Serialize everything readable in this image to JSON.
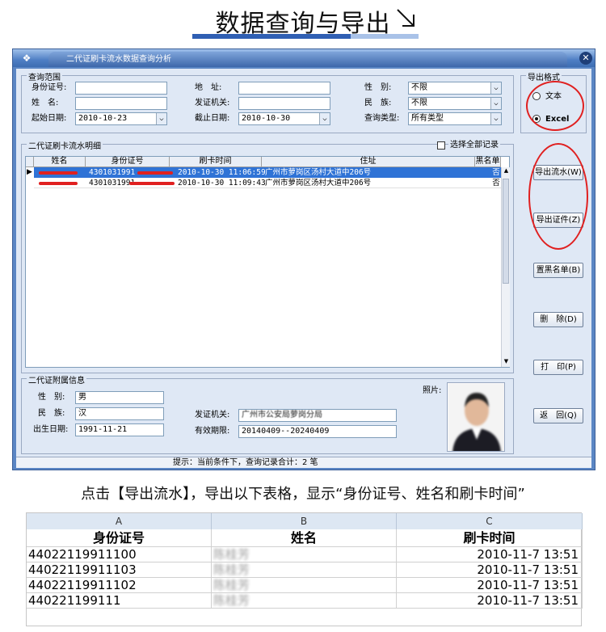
{
  "banner": {
    "title": "数据查询与导出"
  },
  "window": {
    "title": "二代证刷卡流水数据查询分析",
    "query_range": {
      "label": "查询范围",
      "id_no_label": "身份证号:",
      "name_label": "姓　名:",
      "start_date_label": "起始日期:",
      "start_date": "2010-10-23",
      "address_label": "地　址:",
      "issuer_label": "发证机关:",
      "end_date_label": "截止日期:",
      "end_date": "2010-10-30",
      "gender_label": "性　别:",
      "gender_value": "不限",
      "ethnic_label": "民　族:",
      "ethnic_value": "不限",
      "query_type_label": "查询类型:",
      "query_type_value": "所有类型"
    },
    "export_format": {
      "label": "导出格式",
      "text_option": "文本",
      "excel_option": "Excel",
      "selected": "Excel"
    },
    "detail": {
      "label": "二代证刷卡流水明细",
      "select_all": "选择全部记录",
      "columns": [
        "姓名",
        "身份证号",
        "刷卡时间",
        "住址",
        "黑名单"
      ],
      "rows": [
        {
          "name": "",
          "id": "4301031991",
          "time": "2010-10-30 11:06:59",
          "addr": "广州市萝岗区汤村大道中206号",
          "black": "否"
        },
        {
          "name": "",
          "id": "4301031991",
          "time": "2010-10-30 11:09:43",
          "addr": "广州市萝岗区汤村大道中206号",
          "black": "否"
        }
      ]
    },
    "extra": {
      "label": "二代证附属信息",
      "gender_label": "性　别:",
      "gender": "男",
      "ethnic_label": "民　族:",
      "ethnic": "汉",
      "birth_label": "出生日期:",
      "birth": "1991-11-21",
      "issuer_label": "发证机关:",
      "issuer": "广州市公安局萝岗分局",
      "validity_label": "有效期限:",
      "validity": "20140409--20240409",
      "photo_label": "照片:"
    },
    "buttons": {
      "export_flow": "导出流水(W)",
      "export_id": "导出证件(Z)",
      "blacklist": "置黑名单(B)",
      "delete": "删　除(D)",
      "print": "打　印(P)",
      "back": "返　回(Q)"
    },
    "status": "提示：当前条件下，查询记录合计：2 笔"
  },
  "caption": "点击【导出流水】，导出以下表格，显示“身份证号、姓名和刷卡时间”",
  "sheet": {
    "columns": [
      "A",
      "B",
      "C"
    ],
    "headers": [
      "身份证号",
      "姓名",
      "刷卡时间"
    ],
    "rows": [
      {
        "id": "44022119911100",
        "name": "陈桂芳",
        "time": "2010-11-7 13:51"
      },
      {
        "id": "44022119911103",
        "name": "陈桂芳",
        "time": "2010-11-7 13:51"
      },
      {
        "id": "44022119911102",
        "name": "陈桂芳",
        "time": "2010-11-7 13:51"
      },
      {
        "id": "440221199111",
        "name": "陈桂芳",
        "time": "2010-11-7 13:51"
      }
    ]
  }
}
